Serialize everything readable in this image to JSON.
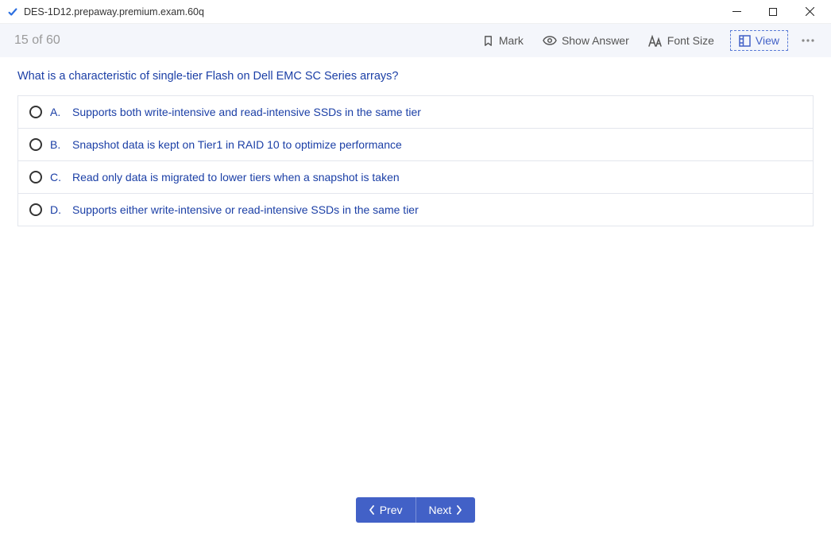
{
  "window": {
    "title": "DES-1D12.prepaway.premium.exam.60q"
  },
  "toolbar": {
    "progress": "15 of 60",
    "mark": "Mark",
    "show_answer": "Show Answer",
    "font_size": "Font Size",
    "view": "View"
  },
  "question": {
    "text": "What is a characteristic of single-tier Flash on Dell EMC SC Series arrays?",
    "answers": [
      {
        "letter": "A.",
        "text": "Supports both write-intensive and read-intensive SSDs in the same tier"
      },
      {
        "letter": "B.",
        "text": "Snapshot data is kept on Tier1 in RAID 10 to optimize performance"
      },
      {
        "letter": "C.",
        "text": "Read only data is migrated to lower tiers when a snapshot is taken"
      },
      {
        "letter": "D.",
        "text": "Supports either write-intensive or read-intensive SSDs in the same tier"
      }
    ]
  },
  "footer": {
    "prev": "Prev",
    "next": "Next"
  }
}
